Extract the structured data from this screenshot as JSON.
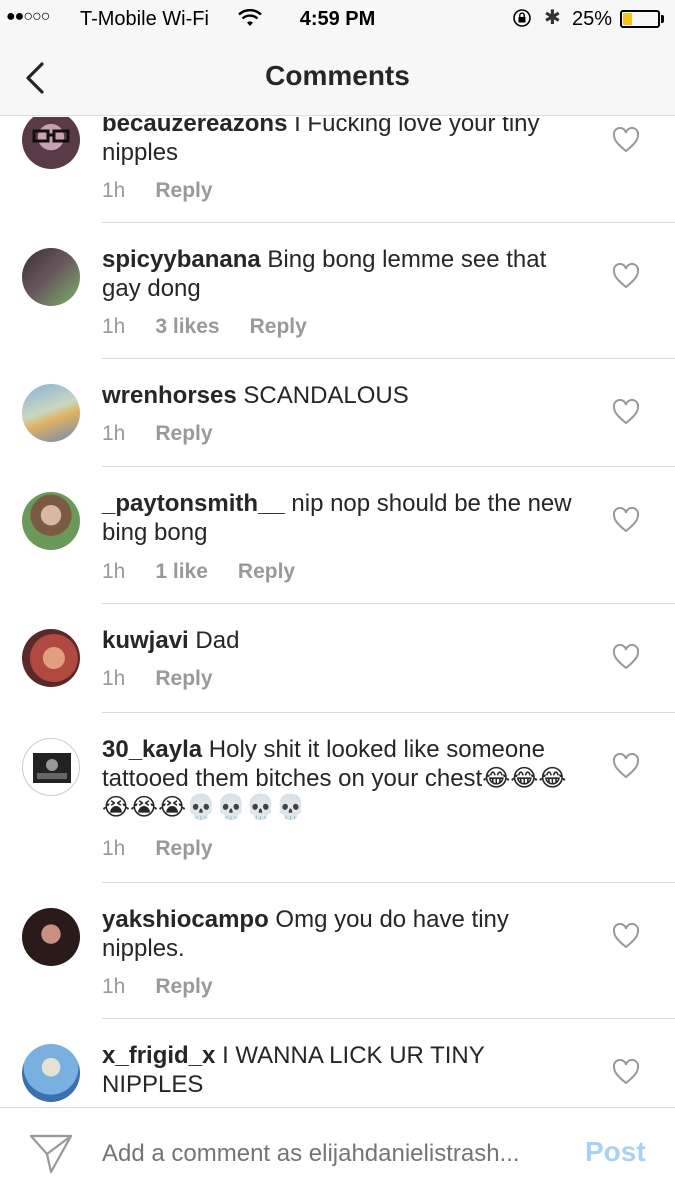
{
  "status_bar": {
    "signal": "●●○○○",
    "carrier": "T-Mobile Wi-Fi",
    "time": "4:59 PM",
    "battery_percent": "25%",
    "battery_level": 0.25,
    "battery_color": "#f5c518"
  },
  "nav": {
    "title": "Comments",
    "back_icon": "chevron-left-icon"
  },
  "comments": [
    {
      "username": "becauzereazons",
      "text": "I Fucking love your tiny nipples",
      "time": "1h",
      "likes": "",
      "reply": "Reply"
    },
    {
      "username": "spicyybanana",
      "text": "Bing bong lemme see that gay dong",
      "time": "1h",
      "likes": "3 likes",
      "reply": "Reply"
    },
    {
      "username": "wrenhorses",
      "text": "SCANDALOUS",
      "time": "1h",
      "likes": "",
      "reply": "Reply"
    },
    {
      "username": "_paytonsmith__",
      "text": "nip nop should be the new bing bong",
      "time": "1h",
      "likes": "1 like",
      "reply": "Reply"
    },
    {
      "username": "kuwjavi",
      "text": "Dad",
      "time": "1h",
      "likes": "",
      "reply": "Reply"
    },
    {
      "username": "30_kayla",
      "text": "Holy shit it looked like someone tattooed them bitches on your chest😂😂😂😭😭😭💀💀💀💀",
      "time": "1h",
      "likes": "",
      "reply": "Reply"
    },
    {
      "username": "yakshiocampo",
      "text": "Omg you do have tiny nipples.",
      "time": "1h",
      "likes": "",
      "reply": "Reply"
    },
    {
      "username": "x_frigid_x",
      "text": "I WANNA LICK UR TINY NIPPLES",
      "time": "",
      "likes": "",
      "reply": ""
    }
  ],
  "compose": {
    "placeholder": "Add a comment as elijahdanielistrash...",
    "post_label": "Post",
    "post_color": "#a8d1f5",
    "send_icon": "paper-plane-icon"
  }
}
